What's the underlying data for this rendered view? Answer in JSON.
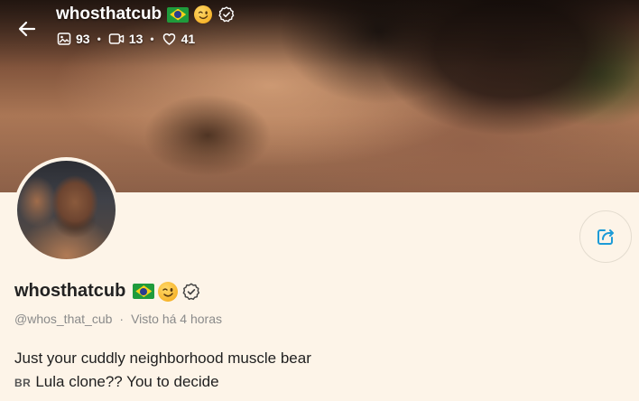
{
  "header": {
    "title": "whosthatcub",
    "stats": {
      "photos": "93",
      "videos": "13",
      "likes": "41"
    }
  },
  "profile": {
    "display_name": "whosthatcub",
    "handle": "@whos_that_cub",
    "separator": "·",
    "last_seen": "Visto há 4 horas",
    "bio": {
      "line1": "Just your cuddly neighborhood muscle bear",
      "line2_prefix": "BR",
      "line2": "Lula clone?? You to decide"
    }
  },
  "icons": {
    "back": "arrow-left-icon",
    "photos": "image-icon",
    "videos": "video-icon",
    "likes": "heart-icon",
    "share": "share-icon",
    "flag": "brazil-flag-icon",
    "emoji": "winking-face-icon",
    "verified": "verified-icon"
  },
  "colors": {
    "background": "#fdf4e8",
    "accent": "#1d9bd7",
    "text": "#222222",
    "muted": "#8a8a8a"
  }
}
